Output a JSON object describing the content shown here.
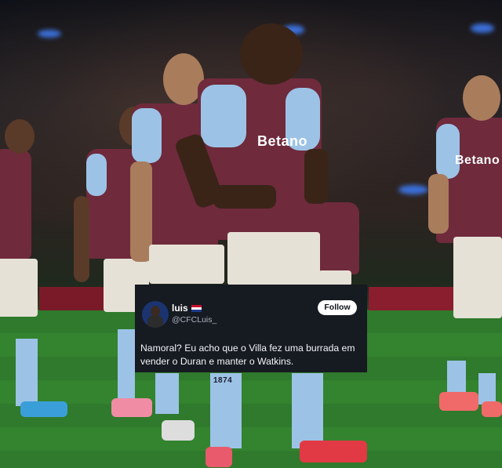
{
  "post": {
    "display_name": "luis",
    "handle": "@CFCLuis_",
    "follow_label": "Follow",
    "text": "Namoral? Eu acho que o Villa fez uma burrada em vender o Duran e manter o Watkins."
  },
  "photo": {
    "sponsor_text": "Betano",
    "shirt_number_1": "1874"
  },
  "colors": {
    "shirt": "#6f2a3c",
    "sleeve": "#9cc3e6",
    "card_bg": "#161a21"
  }
}
